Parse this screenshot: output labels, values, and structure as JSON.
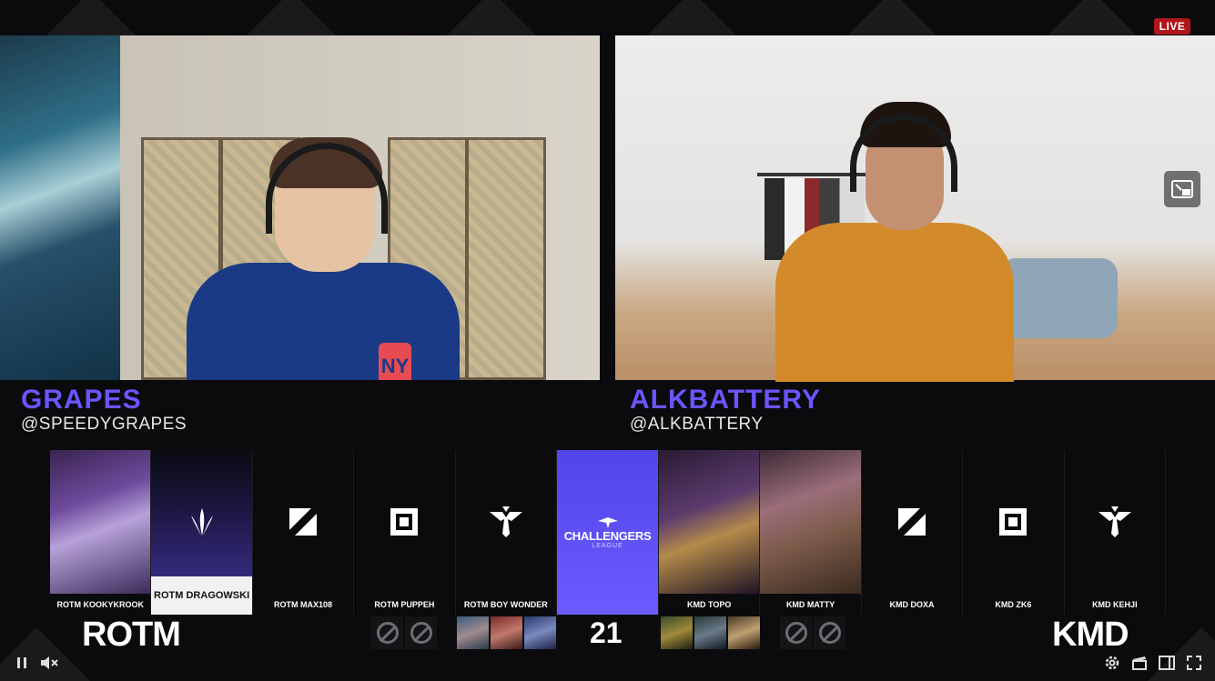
{
  "stream": {
    "live_label": "LIVE"
  },
  "casters": [
    {
      "name": "GRAPES",
      "handle": "@SPEEDYGRAPES"
    },
    {
      "name": "ALKBATTERY",
      "handle": "@ALKBATTERY"
    }
  ],
  "league": {
    "logo_line1": "CHALLENGERS",
    "logo_line2": "LEAGUE"
  },
  "players_left": [
    {
      "label": "ROTM KOOKYKROOK"
    },
    {
      "label": "ROTM DRAGOWSKI"
    },
    {
      "label": "ROTM MAX108"
    },
    {
      "label": "ROTM PUPPEH"
    },
    {
      "label": "ROTM BOY WONDER"
    }
  ],
  "players_right": [
    {
      "label": "KMD TOPO"
    },
    {
      "label": "KMD MATTY"
    },
    {
      "label": "KMD DOXA"
    },
    {
      "label": "KMD ZK6"
    },
    {
      "label": "KMD KEHJI"
    }
  ],
  "scoreboard": {
    "team_left": "ROTM",
    "team_right": "KMD",
    "timer": "21"
  },
  "colors": {
    "accent": "#6a55ff",
    "live_red": "#b0151a"
  },
  "icons": [
    "pause-icon",
    "mute-icon",
    "settings-icon",
    "clip-icon",
    "theater-icon",
    "fullscreen-icon",
    "pip-icon",
    "ban-icon"
  ]
}
